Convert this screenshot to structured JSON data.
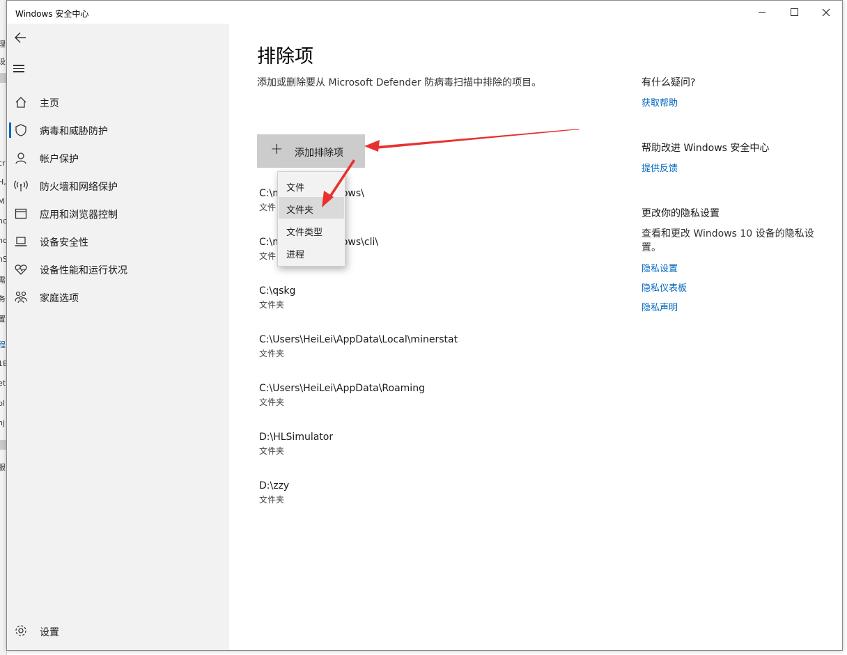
{
  "window": {
    "title": "Windows 安全中心"
  },
  "background_window": {
    "fragments": [
      "理",
      "设",
      "cr",
      "H,",
      "M",
      "nc",
      "nc",
      "nS",
      "需",
      "务",
      "置",
      "程",
      "1E",
      "eti",
      "pl",
      "nj",
      "服"
    ]
  },
  "sidebar": {
    "items": [
      {
        "label": "主页",
        "icon": "home-icon"
      },
      {
        "label": "病毒和威胁防护",
        "icon": "shield-icon",
        "active": true
      },
      {
        "label": "帐户保护",
        "icon": "person-icon"
      },
      {
        "label": "防火墙和网络保护",
        "icon": "wifi-antenna-icon"
      },
      {
        "label": "应用和浏览器控制",
        "icon": "browser-window-icon"
      },
      {
        "label": "设备安全性",
        "icon": "laptop-icon"
      },
      {
        "label": "设备性能和运行状况",
        "icon": "heart-pulse-icon"
      },
      {
        "label": "家庭选项",
        "icon": "family-icon"
      }
    ],
    "settings_label": "设置"
  },
  "main": {
    "title": "排除项",
    "description": "添加或删除要从 Microsoft Defender 防病毒扫描中排除的项目。",
    "add_button_label": "添加排除项",
    "exclusions": [
      {
        "path": "C:\\m",
        "path_tail": "ows\\",
        "type": "文件"
      },
      {
        "path": "C:\\m",
        "path_tail": "ows\\cli\\",
        "type": "文件"
      },
      {
        "path": "C:\\qskg",
        "type": "文件夹"
      },
      {
        "path": "C:\\Users\\HeiLei\\AppData\\Local\\minerstat",
        "type": "文件夹"
      },
      {
        "path": "C:\\Users\\HeiLei\\AppData\\Roaming",
        "type": "文件夹"
      },
      {
        "path": "D:\\HLSimulator",
        "type": "文件夹"
      },
      {
        "path": "D:\\zzy",
        "type": "文件夹"
      }
    ]
  },
  "dropdown": {
    "items": [
      "文件",
      "文件夹",
      "文件类型",
      "进程"
    ],
    "highlighted": "文件夹"
  },
  "rail": {
    "help_heading": "有什么疑问?",
    "help_link": "获取帮助",
    "improve_heading": "帮助改进 Windows 安全中心",
    "improve_link": "提供反馈",
    "privacy_heading": "更改你的隐私设置",
    "privacy_text": "查看和更改 Windows 10 设备的隐私设置。",
    "privacy_links": [
      "隐私设置",
      "隐私仪表板",
      "隐私声明"
    ]
  },
  "colors": {
    "accent": "#0067c0",
    "annotation": "#e8312f",
    "sidebar_bg": "#f2f2f2"
  }
}
